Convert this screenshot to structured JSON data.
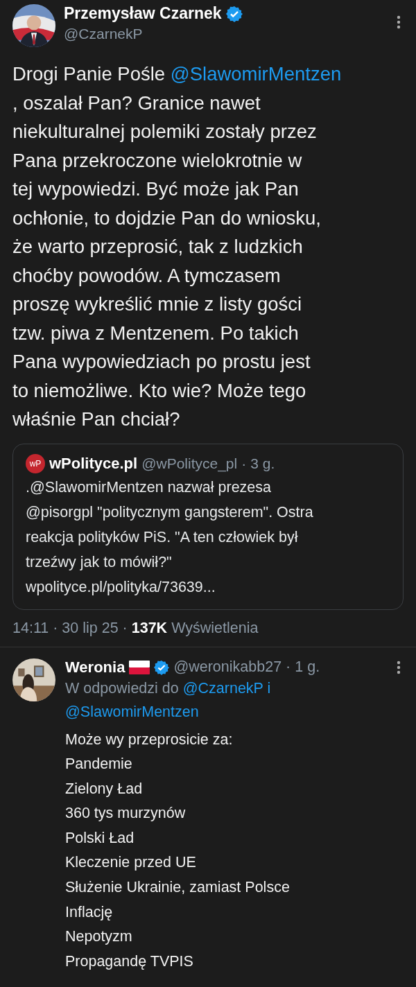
{
  "tweet": {
    "author": {
      "name": "Przemysław Czarnek",
      "verified": true,
      "handle": "@CzarnekP"
    },
    "lines": [
      [
        {
          "text": "Drogi Panie Pośle ",
          "kind": "text"
        },
        {
          "text": "@SlawomirMentzen",
          "kind": "mention"
        }
      ],
      [
        {
          "text": ", oszalał Pan? Granice nawet",
          "kind": "text"
        }
      ],
      [
        {
          "text": "niekulturalnej polemiki zostały przez",
          "kind": "text"
        }
      ],
      [
        {
          "text": "Pana przekroczone wielokrotnie w",
          "kind": "text"
        }
      ],
      [
        {
          "text": "tej wypowiedzi. Być może jak Pan",
          "kind": "text"
        }
      ],
      [
        {
          "text": "ochłonie, to dojdzie Pan do wniosku,",
          "kind": "text"
        }
      ],
      [
        {
          "text": "że warto przeprosić, tak z ludzkich",
          "kind": "text"
        }
      ],
      [
        {
          "text": "choćby powodów. A tymczasem",
          "kind": "text"
        }
      ],
      [
        {
          "text": "proszę wykreślić mnie z listy gości",
          "kind": "text"
        }
      ],
      [
        {
          "text": "tzw. piwa z Mentzenem. Po takich",
          "kind": "text"
        }
      ],
      [
        {
          "text": "Pana wypowiedziach po prostu jest",
          "kind": "text"
        }
      ],
      [
        {
          "text": "to niemożliwe. Kto wie? Może tego",
          "kind": "text"
        }
      ],
      [
        {
          "text": "właśnie Pan chciał?",
          "kind": "text"
        }
      ]
    ],
    "quote": {
      "logo": "wP",
      "name": "wPolityce.pl",
      "handle": "@wPolityce_pl",
      "separator": "·",
      "time": "3 g.",
      "lines": [
        ".@SlawomirMentzen nazwał prezesa",
        "@pisorgpl \"politycznym gangsterem\". Ostra",
        "reakcja polityków PiS. \"A ten człowiek był",
        "trzeźwy jak to mówił?\"",
        "wpolityce.pl/polityka/73639..."
      ]
    },
    "timestamp": "14:11 · 30 lip 25 ·",
    "views": "137K",
    "views_label": "Wyświetlenia"
  },
  "reply": {
    "name": "Weronia",
    "flag": true,
    "verified": true,
    "handle": "@weronikabb27",
    "separator": "·",
    "time": "1 g.",
    "reply_to": [
      {
        "text": "W odpowiedzi do ",
        "kind": "text"
      },
      {
        "text": "@CzarnekP i",
        "kind": "mention"
      },
      {
        "text": "@SlawomirMentzen",
        "kind": "mention"
      }
    ],
    "lines": [
      "Może wy przeprosicie za:",
      "Pandemie",
      "Zielony Ład",
      "360 tys murzynów",
      "Polski Ład",
      "Kleczenie przed UE",
      "Służenie Ukrainie, zamiast Polsce",
      "Inflację",
      "Nepotyzm",
      "Propagandę TVPIS"
    ]
  }
}
